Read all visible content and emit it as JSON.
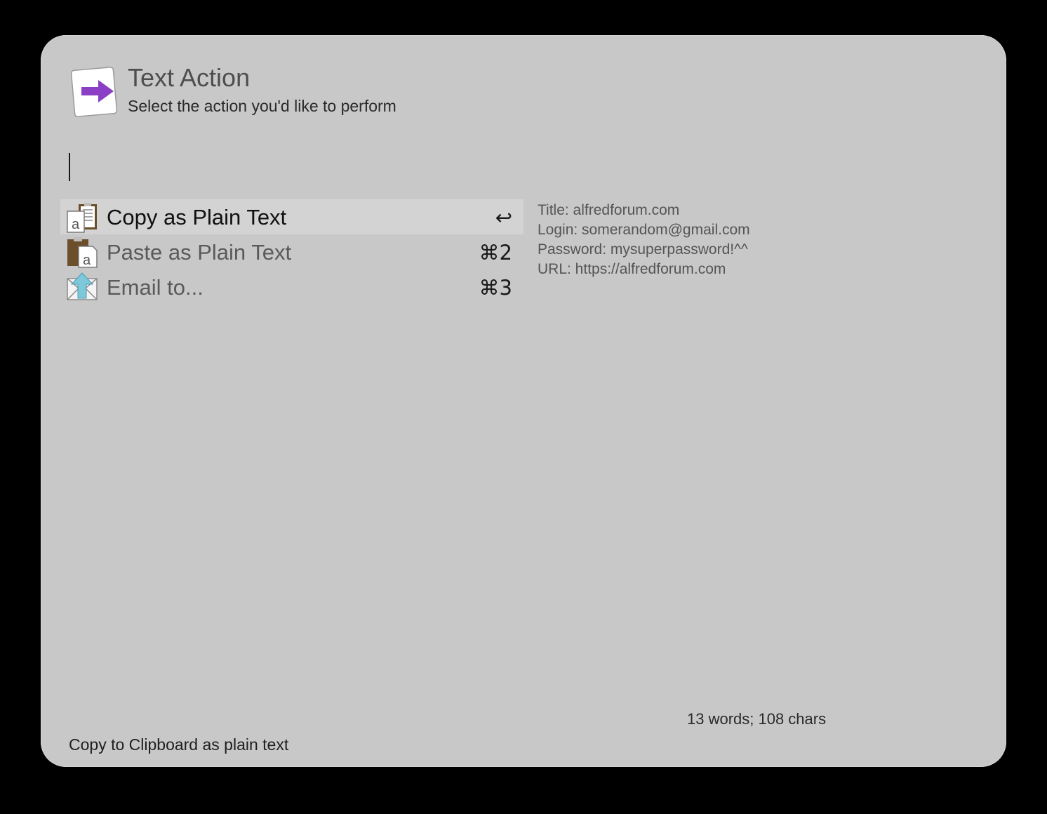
{
  "header": {
    "icon": "text-action-arrow-icon",
    "title": "Text Action",
    "subtitle": "Select the action you'd like to perform"
  },
  "search": {
    "value": ""
  },
  "results": [
    {
      "label": "Copy as Plain Text",
      "shortcut": "↩",
      "icon": "clipboard-copy-icon",
      "selected": true
    },
    {
      "label": "Paste as Plain Text",
      "shortcut": "⌘2",
      "icon": "clipboard-paste-icon",
      "selected": false
    },
    {
      "label": "Email to...",
      "shortcut": "⌘3",
      "icon": "email-icon",
      "selected": false
    }
  ],
  "preview": {
    "lines": [
      "Title: alfredforum.com",
      "Login: somerandom@gmail.com",
      "Password: mysuperpassword!^^",
      "URL: https://alfredforum.com"
    ],
    "stats": "13 words; 108 chars"
  },
  "footer": {
    "text": "Copy to Clipboard as plain text"
  },
  "colors": {
    "window_bg": "#c8c8c8",
    "selected_row_bg": "#d3d3d3",
    "arrow_accent": "#8a3fc4",
    "email_arrow": "#7ec8dc",
    "clipboard_brown": "#6b4e2a"
  }
}
